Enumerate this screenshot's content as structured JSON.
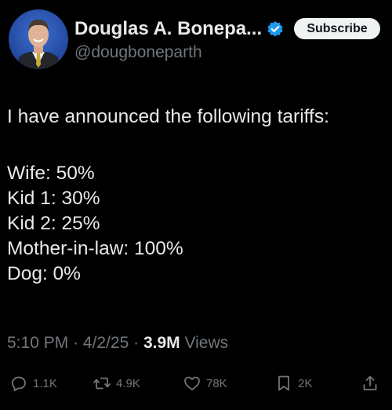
{
  "author": {
    "display_name": "Douglas A. Bonepa...",
    "handle": "@dougboneparth",
    "verified_icon": "verified-badge-icon",
    "verified_color": "#1d9bf0"
  },
  "subscribe_label": "Subscribe",
  "tweet": {
    "lines": [
      "I have announced the following tariffs:",
      "Wife: 50%",
      "Kid 1: 30%",
      "Kid 2: 25%",
      "Mother-in-law: 100%",
      "Dog: 0%"
    ]
  },
  "meta": {
    "time": "5:10 PM",
    "sep1": "·",
    "date": "4/2/25",
    "sep2": "·",
    "views_count": "3.9M",
    "views_label": "Views"
  },
  "actions": {
    "reply": {
      "icon": "reply-icon",
      "count": "1.1K"
    },
    "repost": {
      "icon": "repost-icon",
      "count": "4.9K"
    },
    "like": {
      "icon": "heart-icon",
      "count": "78K"
    },
    "bookmark": {
      "icon": "bookmark-icon",
      "count": "2K"
    },
    "share": {
      "icon": "share-icon"
    }
  },
  "colors": {
    "background": "#000000",
    "text": "#e7e9ea",
    "muted": "#71767b",
    "button_bg": "#eff3f4"
  }
}
